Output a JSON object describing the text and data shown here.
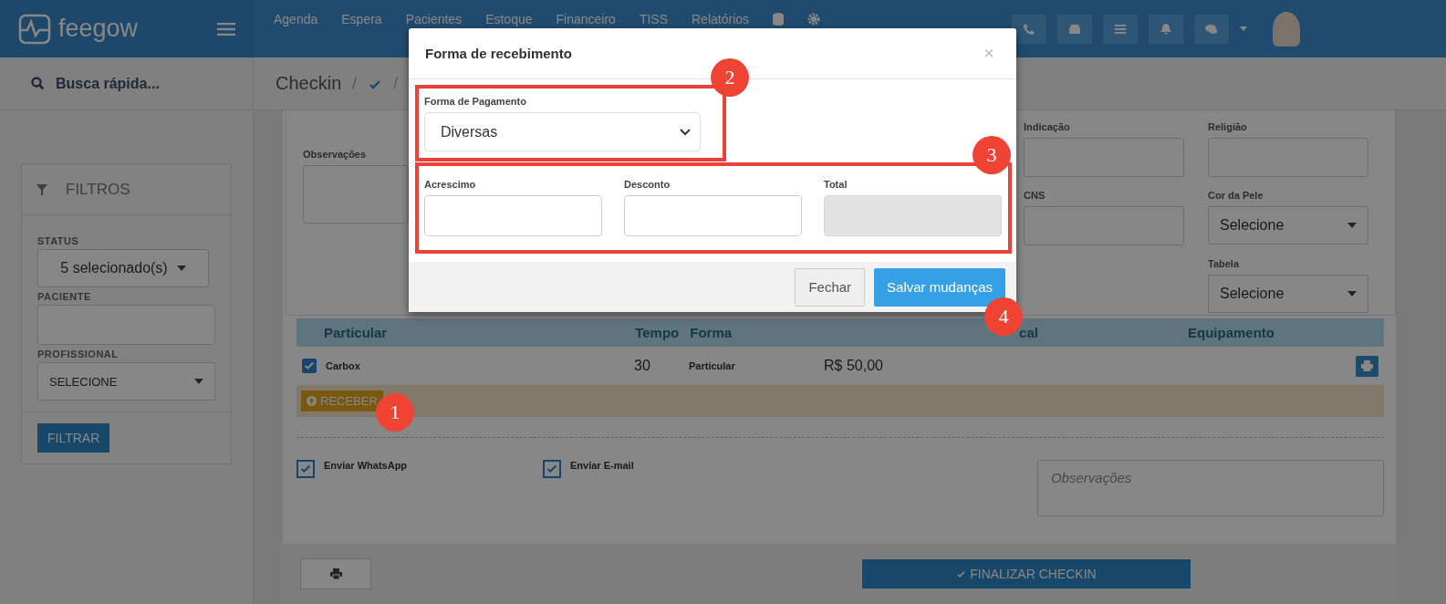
{
  "header": {
    "logo": "feegow",
    "nav": [
      "Agenda",
      "Espera",
      "Pacientes",
      "Estoque",
      "Financeiro",
      "TISS",
      "Relatórios"
    ]
  },
  "sidebar": {
    "search": "Busca rápida...",
    "filters": {
      "title": "FILTROS",
      "fields": [
        {
          "label": "STATUS",
          "kind": "dropdown",
          "value": "5 selecionado(s)"
        },
        {
          "label": "PACIENTE",
          "kind": "text"
        },
        {
          "label": "PROFISSIONAL",
          "kind": "select",
          "value": "SELECIONE"
        }
      ],
      "button": "FILTRAR"
    }
  },
  "breadcrumb": {
    "title": "Checkin",
    "separators": [
      "/",
      "/"
    ]
  },
  "form": {
    "observacoes_label": "Observações",
    "fields": [
      {
        "label": "Indicação",
        "kind": "text"
      },
      {
        "label": "Religião",
        "kind": "text"
      },
      {
        "label": "CNS",
        "kind": "text"
      },
      {
        "label": "Cor da Pele",
        "kind": "select",
        "value": "Selecione"
      },
      {
        "kind": "empty"
      },
      {
        "label": "Tabela",
        "kind": "select",
        "value": "Selecione"
      }
    ]
  },
  "table": {
    "columns": [
      "Particular",
      "Tempo",
      "Forma",
      "cal",
      "Equipamento"
    ],
    "rows": [
      {
        "checked": true,
        "name": "Carbox",
        "tempo": "30",
        "forma": "Particular",
        "valor": "R$ 50,00"
      }
    ],
    "receive_button": "RECEBER"
  },
  "options": [
    {
      "label": "Enviar WhatsApp",
      "checked": true
    },
    {
      "label": "Enviar E-mail",
      "checked": true
    }
  ],
  "notes_placeholder": "Observações",
  "footer": {
    "finish_button": "FINALIZAR CHECKIN"
  },
  "modal": {
    "title": "Forma de recebimento",
    "close": "×",
    "payment_label": "Forma de Pagamento",
    "payment_value": "Diversas",
    "amounts": [
      {
        "label": "Acrescimo",
        "readonly": false
      },
      {
        "label": "Desconto",
        "readonly": false
      },
      {
        "label": "Total",
        "readonly": true
      }
    ],
    "buttons": [
      {
        "label": "Fechar",
        "primary": false
      },
      {
        "label": "Salvar mudanças",
        "primary": true
      }
    ]
  },
  "annotations": [
    "1",
    "2",
    "3",
    "4"
  ]
}
